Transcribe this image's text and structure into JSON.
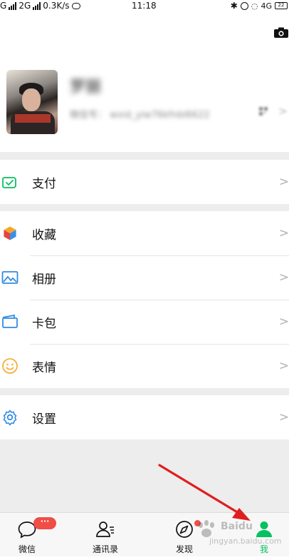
{
  "status_bar": {
    "left_text": "G",
    "network_label": "2G",
    "speed": "0.3K/s",
    "time": "11:18",
    "network_4g": "4G",
    "battery_level": "22"
  },
  "profile": {
    "nickname": "罗丽",
    "wechat_id_label": "微信号：",
    "wechat_id": "wxid_yiw76kfnbl6622",
    "chevron": ">"
  },
  "menu": {
    "pay": {
      "label": "支付",
      "icon": "wallet-check-icon"
    },
    "favorites": {
      "label": "收藏",
      "icon": "cube-icon"
    },
    "album": {
      "label": "相册",
      "icon": "photo-icon"
    },
    "cards": {
      "label": "卡包",
      "icon": "card-wallet-icon"
    },
    "stickers": {
      "label": "表情",
      "icon": "smiley-icon"
    },
    "settings": {
      "label": "设置",
      "icon": "gear-icon"
    },
    "chevron": ">"
  },
  "tabbar": {
    "chats": {
      "label": "微信",
      "badge": "···"
    },
    "contacts": {
      "label": "通讯录"
    },
    "discover": {
      "label": "发现"
    },
    "me": {
      "label": "我"
    }
  },
  "watermark": {
    "brand": "Baidu",
    "sub": "jingyan.baidu.com"
  },
  "colors": {
    "accent_green": "#07c160",
    "badge_red": "#f04d45",
    "arrow_red": "#e01e1e"
  }
}
